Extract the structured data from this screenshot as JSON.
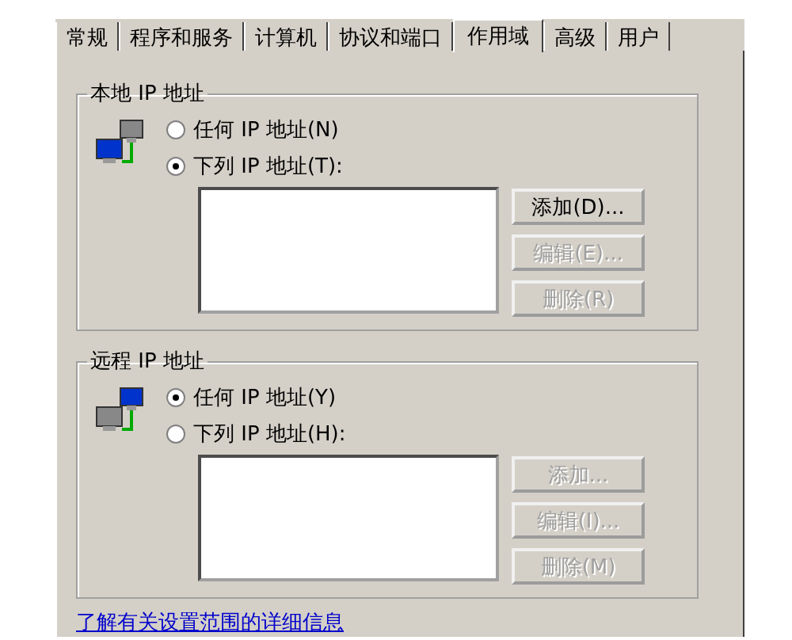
{
  "tabs": [
    {
      "label": "常规",
      "selected": false
    },
    {
      "label": "程序和服务",
      "selected": false
    },
    {
      "label": "计算机",
      "selected": false
    },
    {
      "label": "协议和端口",
      "selected": false
    },
    {
      "label": "作用域",
      "selected": true
    },
    {
      "label": "高级",
      "selected": false
    },
    {
      "label": "用户",
      "selected": false
    }
  ],
  "groups": [
    {
      "title": "本地 IP 地址",
      "options": [
        {
          "label": "任何 IP 地址(N)",
          "selected": false
        },
        {
          "label": "下列 IP 地址(T):",
          "selected": true
        }
      ],
      "buttons": [
        {
          "label": "添加(D)...",
          "disabled": false
        },
        {
          "label": "编辑(E)...",
          "disabled": true
        },
        {
          "label": "删除(R)",
          "disabled": true
        }
      ]
    },
    {
      "title": "远程 IP 地址",
      "options": [
        {
          "label": "任何 IP 地址(Y)",
          "selected": true
        },
        {
          "label": "下列 IP 地址(H):",
          "selected": false
        }
      ],
      "buttons": [
        {
          "label": "添加...",
          "disabled": true
        },
        {
          "label": "编辑(I)...",
          "disabled": true
        },
        {
          "label": "删除(M)",
          "disabled": true
        }
      ]
    }
  ],
  "link": "了解有关设置范围的详细信息"
}
